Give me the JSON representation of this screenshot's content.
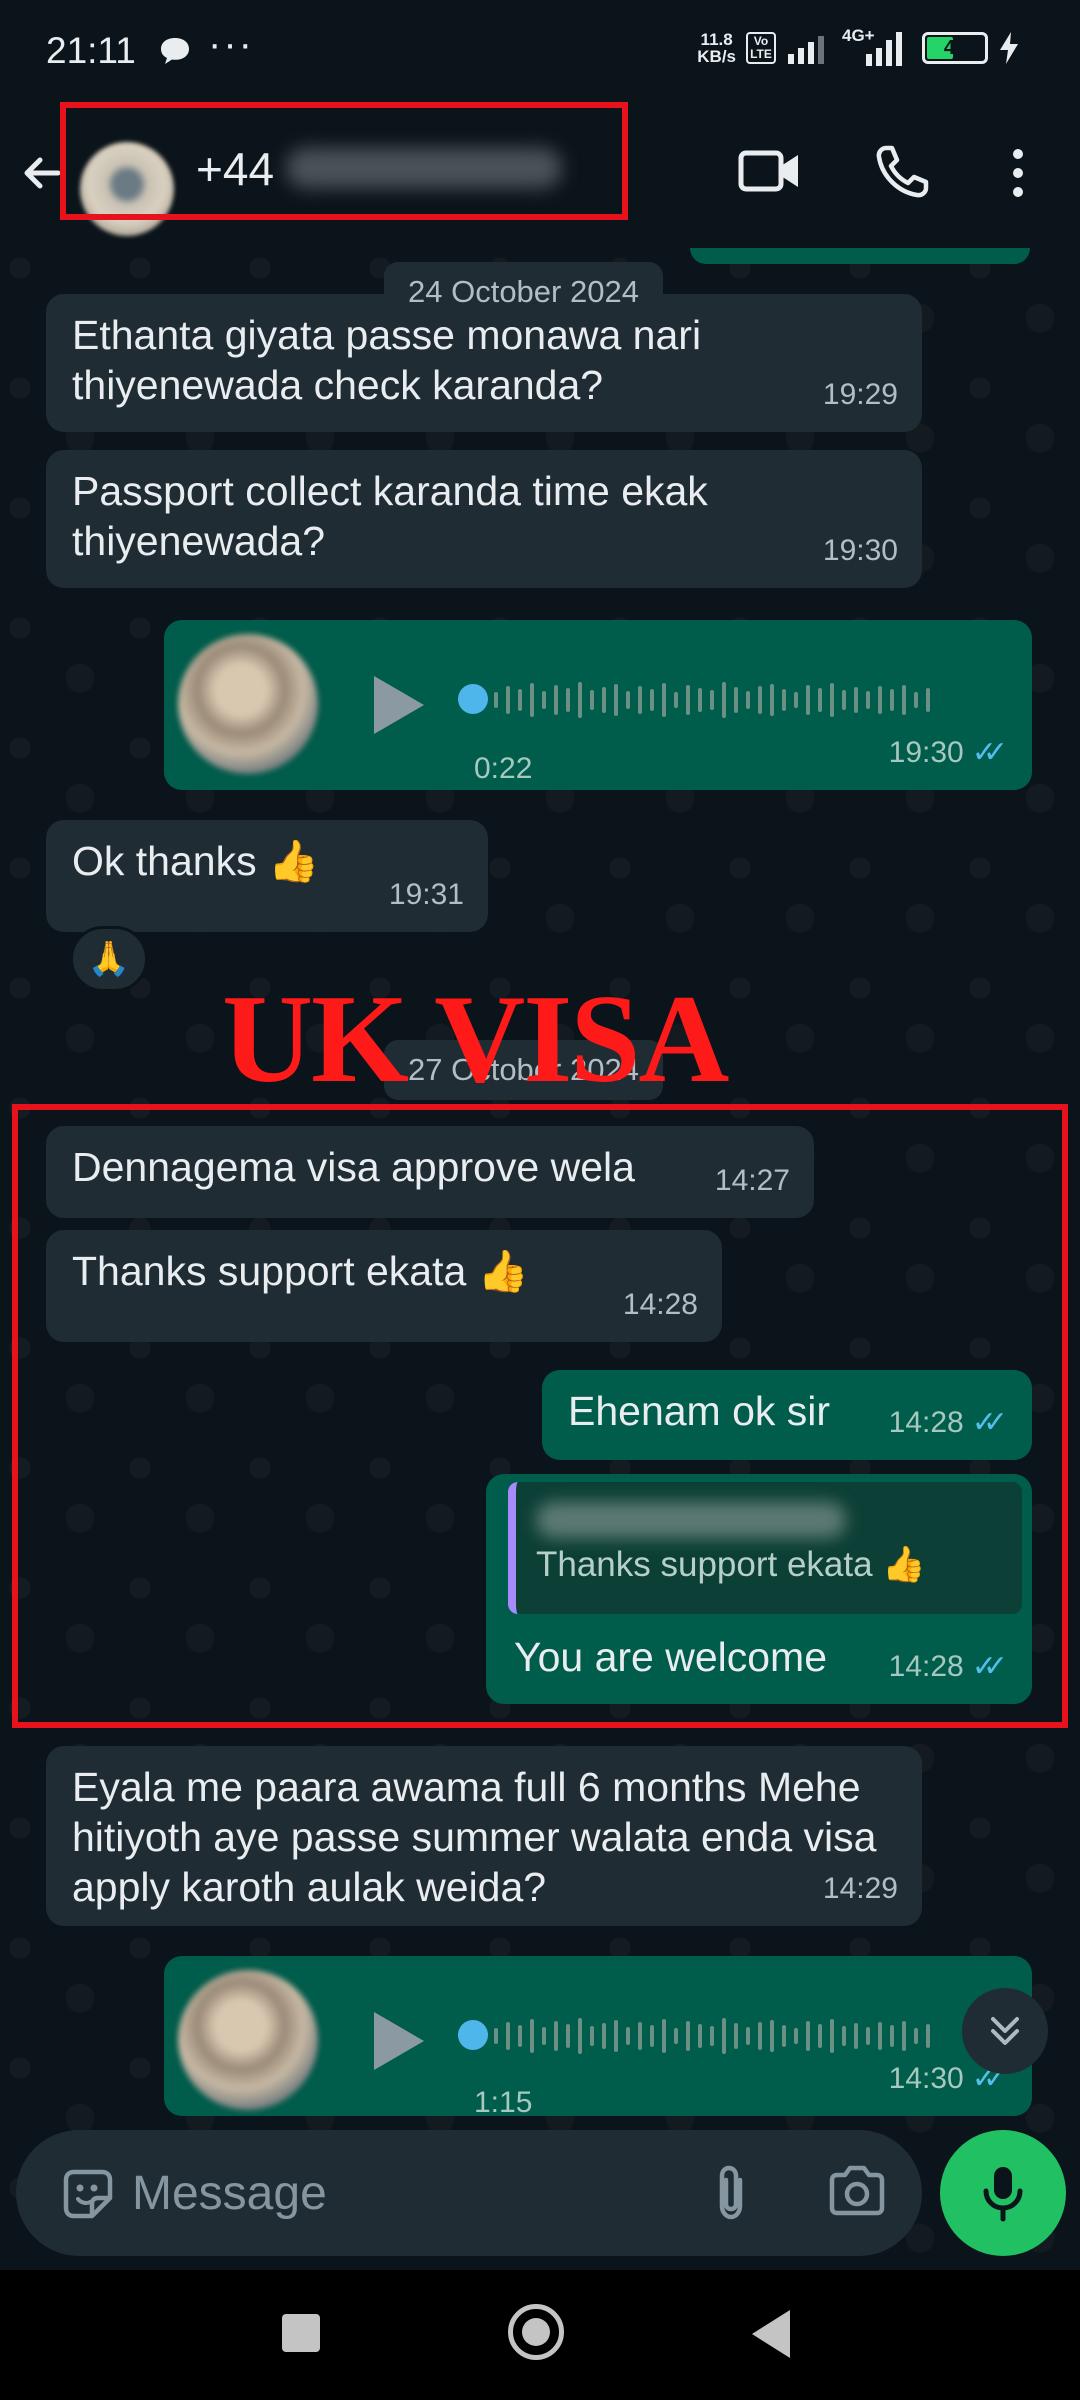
{
  "status_bar": {
    "time": "21:11",
    "dots": "···",
    "net_speed": "11.8",
    "net_unit": "KB/s",
    "volte_top": "Vo",
    "volte_bottom": "LTE",
    "network": "4G+",
    "battery": "44",
    "battery_level": 0.44
  },
  "header": {
    "contact_prefix": "+44",
    "icons": [
      "back-arrow-icon",
      "video-call-icon",
      "phone-icon",
      "more-vert-icon"
    ]
  },
  "overlay": {
    "title": "UK VISA",
    "highlight_color": "#e8121c"
  },
  "dates": {
    "first": "24 October 2024",
    "second": "27 October 2024"
  },
  "messages": [
    {
      "dir": "in",
      "text": "Ethanta giyata passe monawa nari thiyenewada check karanda?",
      "time": "19:29"
    },
    {
      "dir": "in",
      "text": "Passport collect karanda time ekak thiyenewada?",
      "time": "19:30"
    },
    {
      "dir": "out",
      "type": "voice",
      "duration": "0:22",
      "time": "19:30",
      "ticks": "✓✓"
    },
    {
      "dir": "in",
      "text": "Ok thanks 👍",
      "time": "19:31",
      "reaction": "🙏"
    },
    {
      "dir": "in",
      "text": "Dennagema visa approve wela",
      "time": "14:27"
    },
    {
      "dir": "in",
      "text": "Thanks support ekata 👍",
      "time": "14:28"
    },
    {
      "dir": "out",
      "text": "Ehenam ok sir",
      "time": "14:28",
      "ticks": "✓✓"
    },
    {
      "dir": "out",
      "text": "You are welcome",
      "time": "14:28",
      "ticks": "✓✓",
      "quoted_text": "Thanks support ekata 👍"
    },
    {
      "dir": "in",
      "text": "Eyala me paara awama full 6 months Mehe hitiyoth aye passe summer walata enda visa apply karoth aulak weida?",
      "time": "14:29"
    },
    {
      "dir": "out",
      "type": "voice",
      "duration": "1:15",
      "time": "14:30",
      "ticks": "✓✓"
    }
  ],
  "input": {
    "placeholder": "Message"
  },
  "colors": {
    "background": "#0b141a",
    "incoming": "#202c33",
    "outgoing": "#005c4b",
    "read_ticks": "#53bdeb",
    "mic": "#21c063"
  }
}
